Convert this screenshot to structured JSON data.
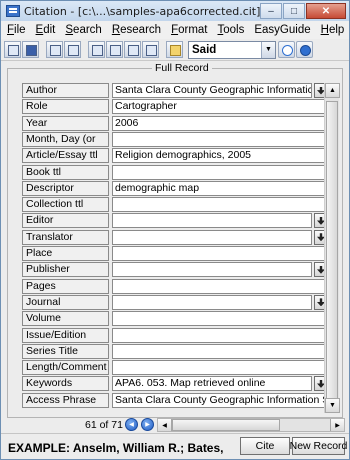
{
  "window": {
    "title": "Citation - [c:\\...\\samples-apa6corrected.cit]",
    "buttons": {
      "minimize": "–",
      "maximize": "□",
      "close": "✕"
    }
  },
  "menubar": {
    "items": [
      {
        "key": "F",
        "rest": "ile"
      },
      {
        "key": "E",
        "rest": "dit"
      },
      {
        "key": "S",
        "rest": "earch"
      },
      {
        "key": "R",
        "rest": "esearch"
      },
      {
        "key": "F",
        "rest": "ormat"
      },
      {
        "key": "T",
        "rest": "ools"
      },
      {
        "key": "",
        "rest": "EasyGuide"
      },
      {
        "key": "H",
        "rest": "elp"
      }
    ]
  },
  "toolbar": {
    "icons": [
      "new-file-icon",
      "save-icon",
      "list-view-icon",
      "two-pane-icon",
      "record-view-icon",
      "page-icon",
      "multi-page-icon",
      "report-icon",
      "note-icon"
    ],
    "said_value": "Said"
  },
  "record": {
    "group_title": "Full Record",
    "fields": [
      {
        "label": "Author",
        "value": "Santa Clara County Geographic Informatic",
        "dropdown": true
      },
      {
        "label": "Role",
        "value": "Cartographer",
        "dropdown": false
      },
      {
        "label": "Year",
        "value": "2006",
        "dropdown": false
      },
      {
        "label": "Month, Day (or",
        "value": "",
        "dropdown": false
      },
      {
        "label": "Article/Essay ttl",
        "value": "Religion demographics, 2005",
        "dropdown": false
      },
      {
        "label": "Book ttl",
        "value": "",
        "dropdown": false
      },
      {
        "label": "Descriptor",
        "value": "demographic map",
        "dropdown": false
      },
      {
        "label": "Collection ttl",
        "value": "",
        "dropdown": false
      },
      {
        "label": "Editor",
        "value": "",
        "dropdown": true
      },
      {
        "label": "Translator",
        "value": "",
        "dropdown": true
      },
      {
        "label": "Place",
        "value": "",
        "dropdown": false
      },
      {
        "label": "Publisher",
        "value": "",
        "dropdown": true
      },
      {
        "label": "Pages",
        "value": "",
        "dropdown": false
      },
      {
        "label": "Journal",
        "value": "",
        "dropdown": true
      },
      {
        "label": "Volume",
        "value": "",
        "dropdown": false
      },
      {
        "label": "Issue/Edition",
        "value": "",
        "dropdown": false
      },
      {
        "label": "Series Title",
        "value": "",
        "dropdown": false
      },
      {
        "label": "Length/Comment",
        "value": "",
        "dropdown": false
      },
      {
        "label": "Keywords",
        "value": "APA6. 053. Map retrieved online",
        "dropdown": true
      },
      {
        "label": "Access Phrase",
        "value": "Santa Clara County Geographic Information S",
        "dropdown": false
      }
    ]
  },
  "navigation": {
    "record_count": "61 of 71"
  },
  "status": {
    "example": "EXAMPLE: Anselm, William R.; Bates,",
    "cite_label": "Cite",
    "new_record_label": "New Record"
  }
}
